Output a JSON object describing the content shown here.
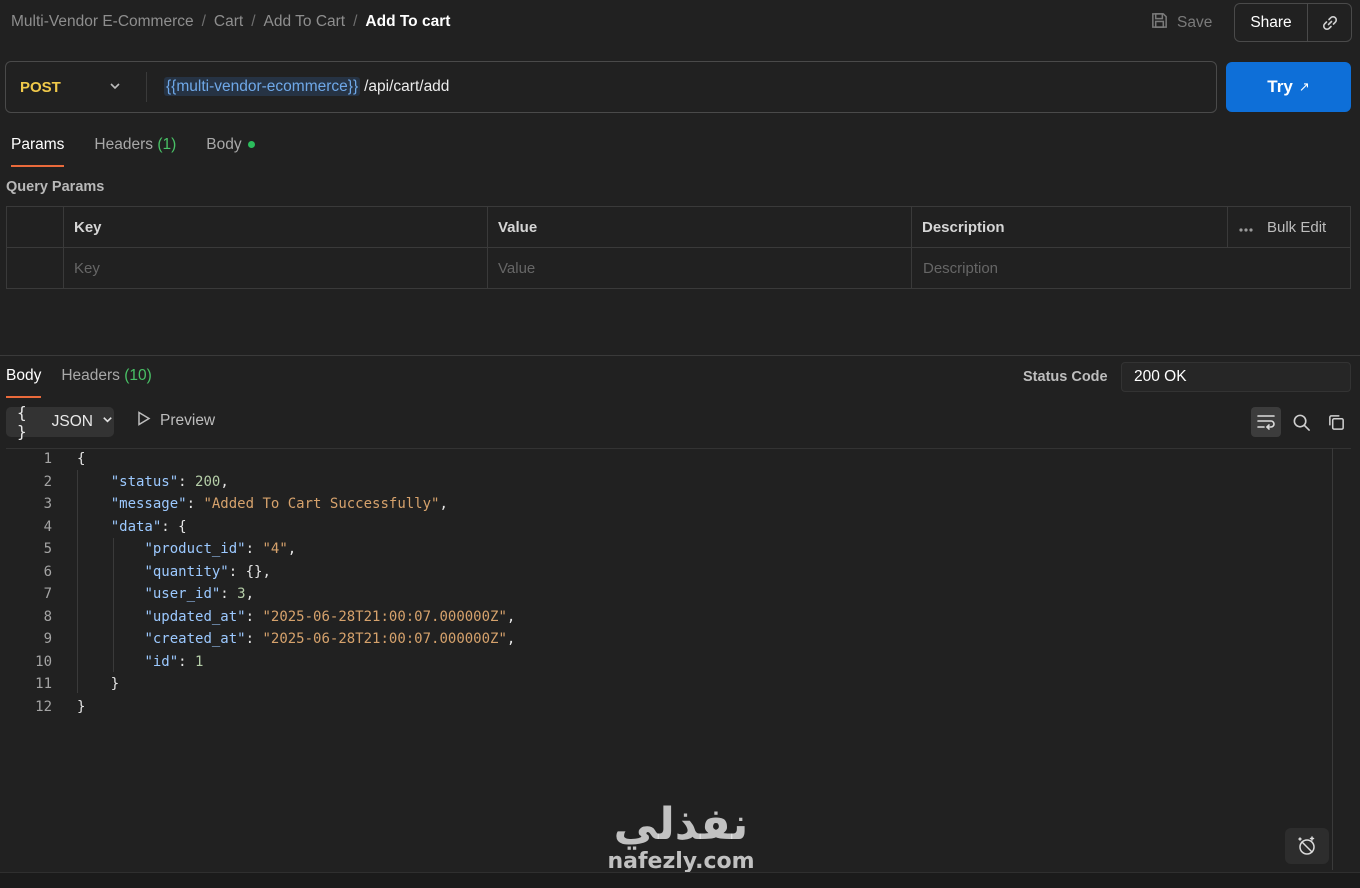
{
  "breadcrumb": {
    "items": [
      "Multi-Vendor E-Commerce",
      "Cart",
      "Add To Cart"
    ],
    "separator": "/",
    "current": "Add To cart"
  },
  "toolbar": {
    "save_label": "Save",
    "share_label": "Share"
  },
  "request": {
    "method": "POST",
    "url_variable": "{{multi-vendor-ecommerce}}",
    "url_path": "/api/cart/add",
    "try_label": "Try",
    "try_icon": "↗"
  },
  "request_tabs": {
    "params": "Params",
    "headers": "Headers",
    "headers_count": "(1)",
    "body": "Body"
  },
  "query_params": {
    "title": "Query Params",
    "columns": {
      "key": "Key",
      "value": "Value",
      "description": "Description"
    },
    "bulk_edit": "Bulk Edit",
    "placeholders": {
      "key": "Key",
      "value": "Value",
      "description": "Description"
    }
  },
  "response": {
    "tabs": {
      "body": "Body",
      "headers": "Headers",
      "headers_count": "(10)"
    },
    "status_label": "Status Code",
    "status_value": "200 OK",
    "format": "JSON",
    "format_icon": "{ }",
    "preview_label": "Preview"
  },
  "code_lines": [
    {
      "no": "1",
      "text": "{"
    },
    {
      "no": "2",
      "text": "    \"status\": 200,"
    },
    {
      "no": "3",
      "text": "    \"message\": \"Added To Cart Successfully\","
    },
    {
      "no": "4",
      "text": "    \"data\": {"
    },
    {
      "no": "5",
      "text": "        \"product_id\": \"4\","
    },
    {
      "no": "6",
      "text": "        \"quantity\": {},"
    },
    {
      "no": "7",
      "text": "        \"user_id\": 3,"
    },
    {
      "no": "8",
      "text": "        \"updated_at\": \"2025-06-28T21:00:07.000000Z\","
    },
    {
      "no": "9",
      "text": "        \"created_at\": \"2025-06-28T21:00:07.000000Z\","
    },
    {
      "no": "10",
      "text": "        \"id\": 1"
    },
    {
      "no": "11",
      "text": "    }"
    },
    {
      "no": "12",
      "text": "}"
    }
  ],
  "watermark": {
    "arabic": "نفذلي",
    "latin": "nafezly.com"
  },
  "colors": {
    "background": "#212121",
    "method_post": "#f0c94a",
    "primary_button": "#0e6fd8",
    "tab_underline": "#ea6a3b",
    "count_green": "#49c166",
    "json_key": "#9cc9ff",
    "json_string": "#d6a26c",
    "json_number": "#b5cea8"
  },
  "icons": {
    "save": "save-icon",
    "link": "link-icon",
    "method_dropdown": "chevron-down-icon",
    "bulk_more": "more-horizontal-icon",
    "format_dropdown": "chevron-down-icon",
    "preview": "play-icon",
    "wrap": "wrap-lines-icon",
    "search": "search-icon",
    "copy": "copy-icon",
    "magic": "magic-wand-icon"
  }
}
